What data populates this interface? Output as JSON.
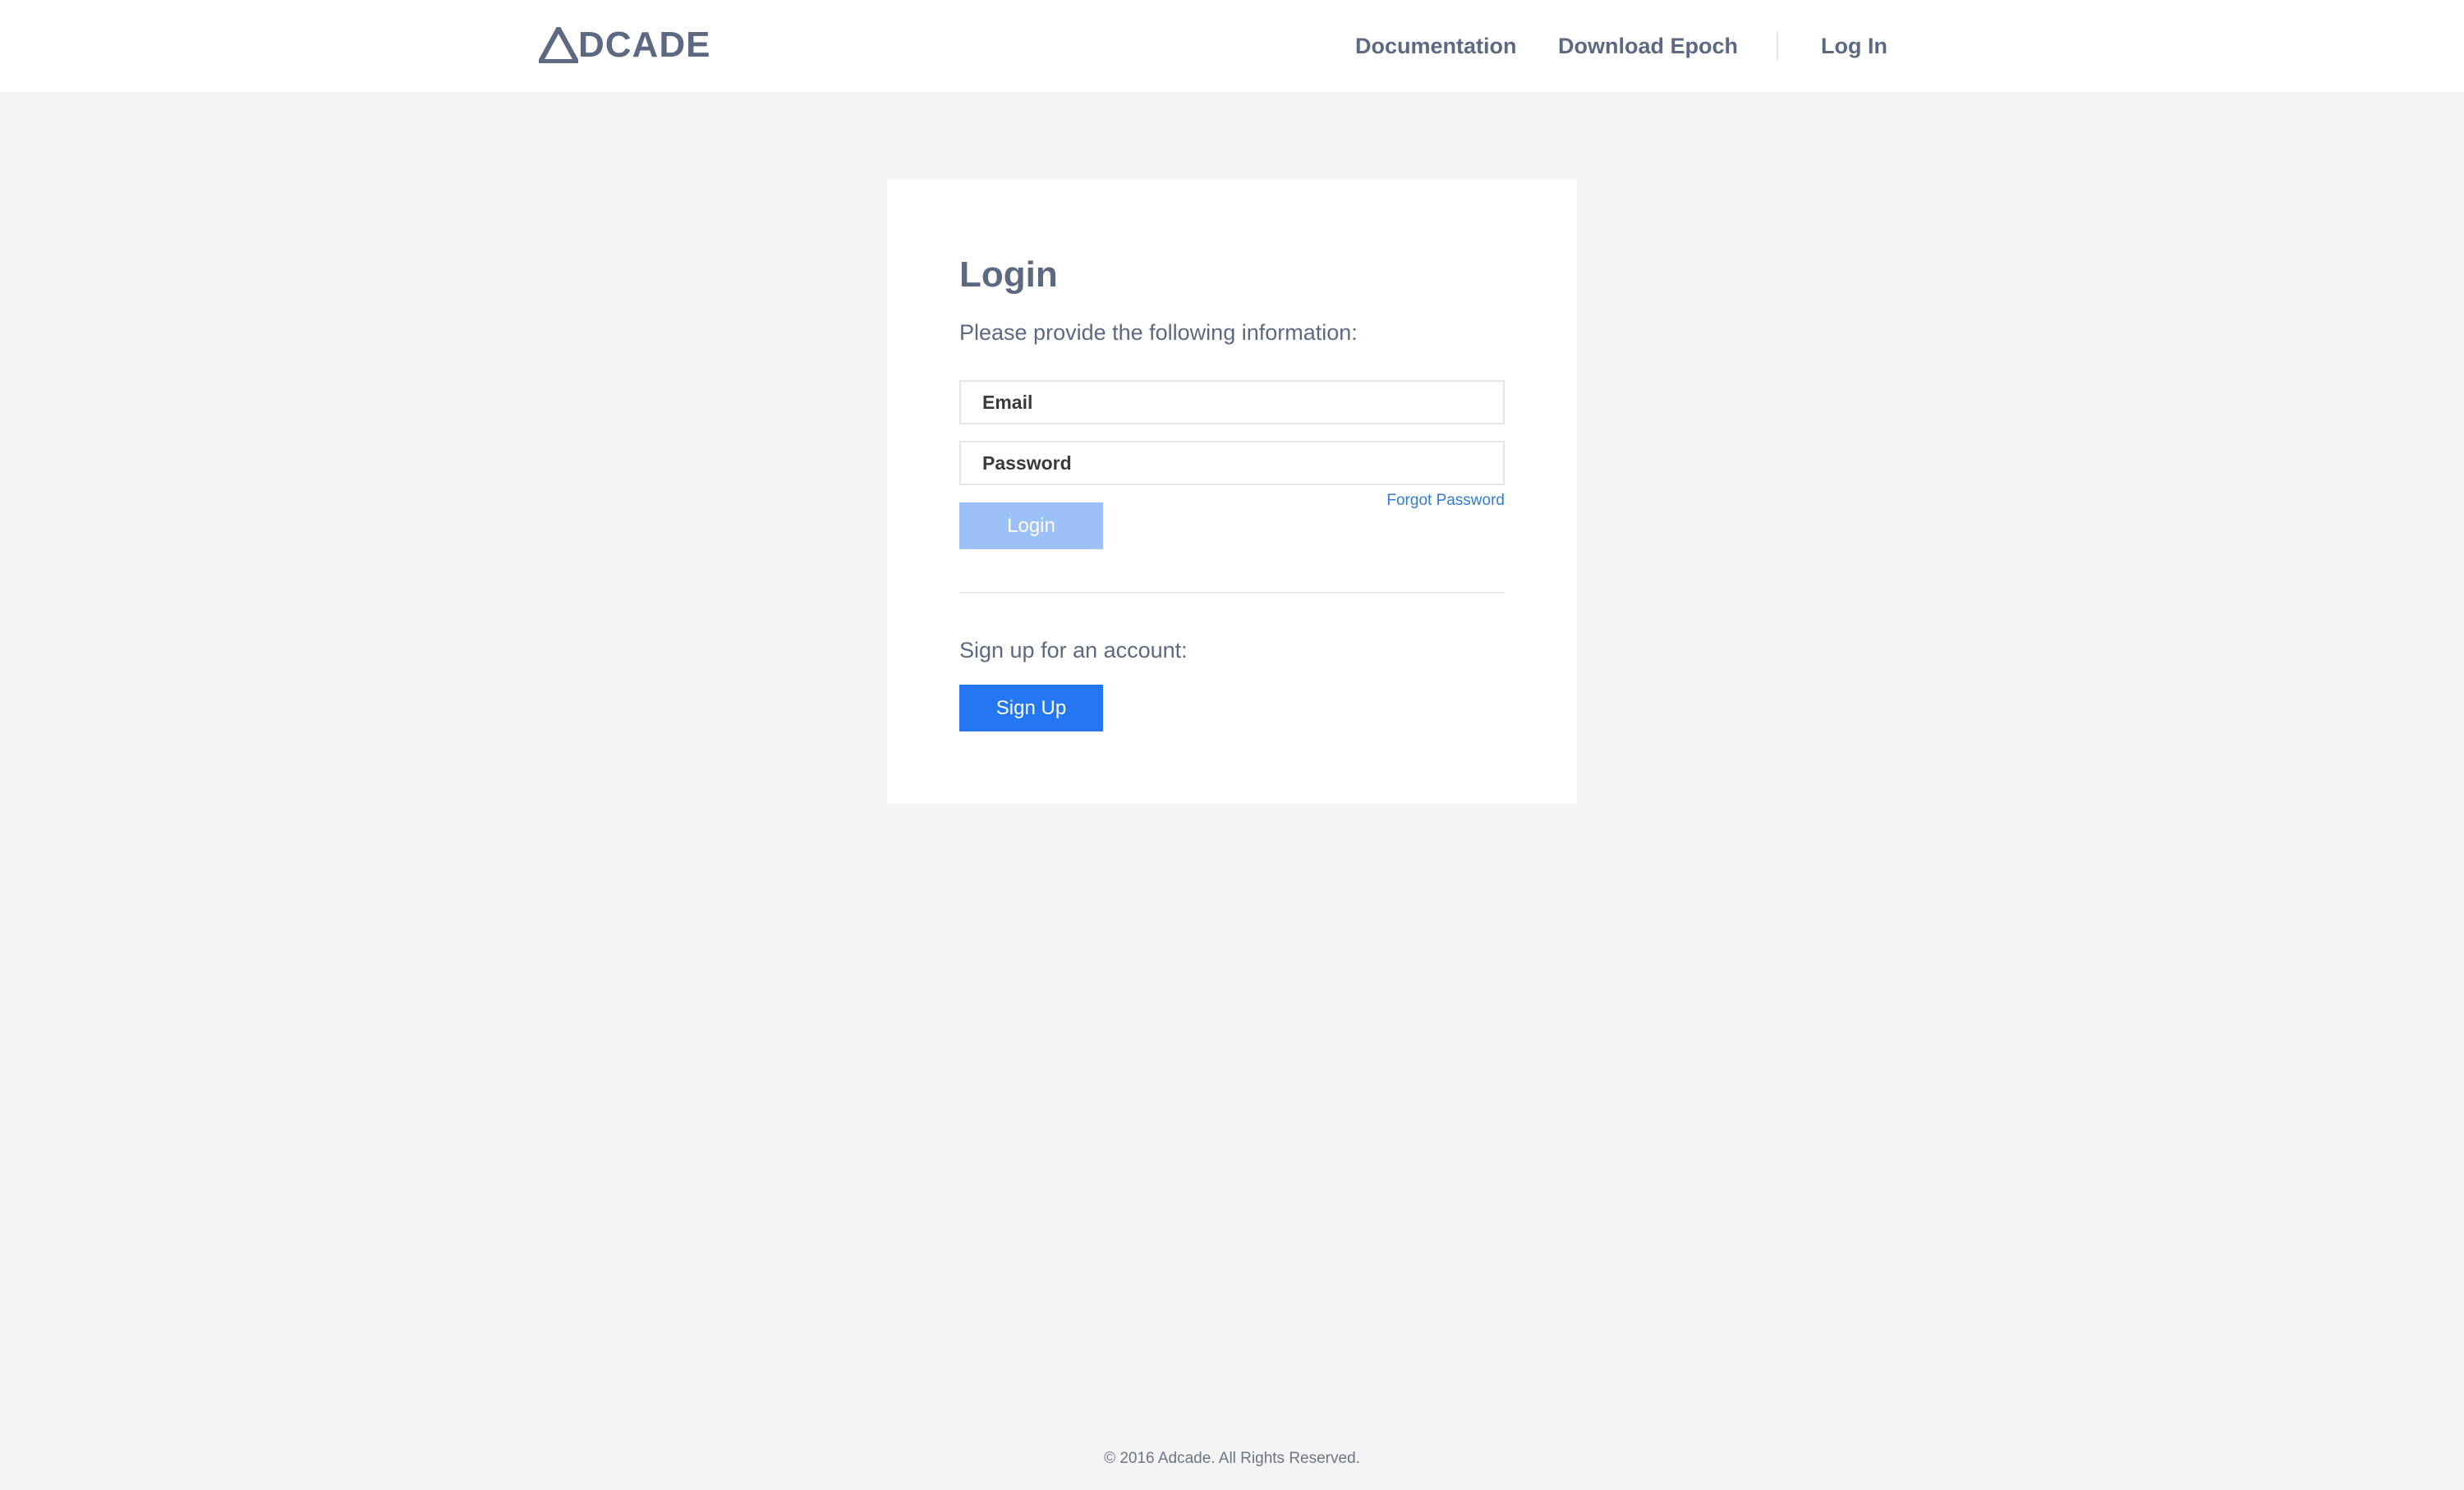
{
  "header": {
    "logo_text": "ADCADE",
    "nav": {
      "documentation": "Documentation",
      "download": "Download Epoch",
      "login": "Log In"
    }
  },
  "login_card": {
    "title": "Login",
    "subtitle": "Please provide the following information:",
    "email": {
      "placeholder": "Email",
      "value": ""
    },
    "password": {
      "placeholder": "Password",
      "value": ""
    },
    "forgot_password": "Forgot Password",
    "login_button": "Login",
    "signup_prompt": "Sign up for an account:",
    "signup_button": "Sign Up"
  },
  "footer": {
    "copyright": "© 2016 Adcade. All Rights Reserved."
  },
  "colors": {
    "background": "#f4f4f4",
    "text": "#5b6a82",
    "primary": "#2576f1",
    "primary_disabled": "#9cc1f6",
    "link": "#2f7bd6"
  }
}
